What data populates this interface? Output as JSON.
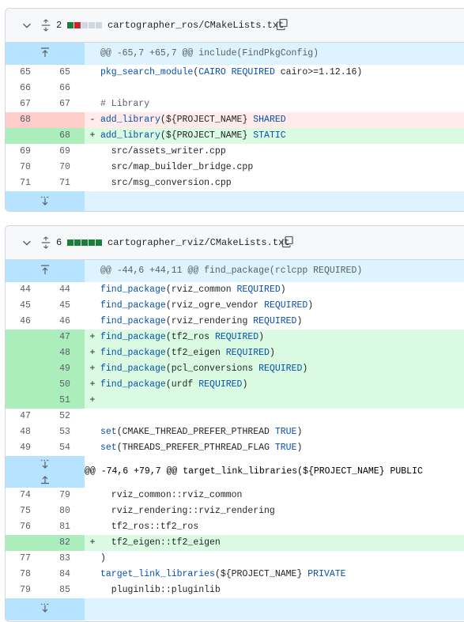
{
  "files": [
    {
      "changes": "2",
      "path": "cartographer_ros/CMakeLists.txt",
      "hunk": "@@ -65,7 +65,7 @@ include(FindPkgConfig)",
      "lines": [
        {
          "type": "ctx",
          "old": "65",
          "new": "65",
          "sign": "",
          "text": "pkg_search_module(CAIRO REQUIRED cairo>=1.12.16)"
        },
        {
          "type": "ctx",
          "old": "66",
          "new": "66",
          "sign": "",
          "text": ""
        },
        {
          "type": "ctx",
          "old": "67",
          "new": "67",
          "sign": "",
          "text": "# Library"
        },
        {
          "type": "del",
          "old": "68",
          "new": "",
          "sign": "-",
          "text": "add_library(${PROJECT_NAME} SHARED"
        },
        {
          "type": "add",
          "old": "",
          "new": "68",
          "sign": "+",
          "text": "add_library(${PROJECT_NAME} STATIC"
        },
        {
          "type": "ctx",
          "old": "69",
          "new": "69",
          "sign": "",
          "text": "  src/assets_writer.cpp"
        },
        {
          "type": "ctx",
          "old": "70",
          "new": "70",
          "sign": "",
          "text": "  src/map_builder_bridge.cpp"
        },
        {
          "type": "ctx",
          "old": "71",
          "new": "71",
          "sign": "",
          "text": "  src/msg_conversion.cpp"
        }
      ]
    },
    {
      "changes": "6",
      "path": "cartographer_rviz/CMakeLists.txt",
      "hunk": "@@ -44,6 +44,11 @@ find_package(rclcpp REQUIRED)",
      "hunk2": "@@ -74,6 +79,7 @@ target_link_libraries(${PROJECT_NAME} PUBLIC",
      "lines": [
        {
          "type": "ctx",
          "old": "44",
          "new": "44",
          "sign": "",
          "text": "find_package(rviz_common REQUIRED)"
        },
        {
          "type": "ctx",
          "old": "45",
          "new": "45",
          "sign": "",
          "text": "find_package(rviz_ogre_vendor REQUIRED)"
        },
        {
          "type": "ctx",
          "old": "46",
          "new": "46",
          "sign": "",
          "text": "find_package(rviz_rendering REQUIRED)"
        },
        {
          "type": "add",
          "old": "",
          "new": "47",
          "sign": "+",
          "text": "find_package(tf2_ros REQUIRED)"
        },
        {
          "type": "add",
          "old": "",
          "new": "48",
          "sign": "+",
          "text": "find_package(tf2_eigen REQUIRED)"
        },
        {
          "type": "add",
          "old": "",
          "new": "49",
          "sign": "+",
          "text": "find_package(pcl_conversions REQUIRED)"
        },
        {
          "type": "add",
          "old": "",
          "new": "50",
          "sign": "+",
          "text": "find_package(urdf REQUIRED)"
        },
        {
          "type": "add",
          "old": "",
          "new": "51",
          "sign": "+",
          "text": ""
        },
        {
          "type": "ctx",
          "old": "47",
          "new": "52",
          "sign": "",
          "text": ""
        },
        {
          "type": "ctx",
          "old": "48",
          "new": "53",
          "sign": "",
          "text": "set(CMAKE_THREAD_PREFER_PTHREAD TRUE)"
        },
        {
          "type": "ctx",
          "old": "49",
          "new": "54",
          "sign": "",
          "text": "set(THREADS_PREFER_PTHREAD_FLAG TRUE)"
        }
      ],
      "lines2": [
        {
          "type": "ctx",
          "old": "74",
          "new": "79",
          "sign": "",
          "text": "  rviz_common::rviz_common"
        },
        {
          "type": "ctx",
          "old": "75",
          "new": "80",
          "sign": "",
          "text": "  rviz_rendering::rviz_rendering"
        },
        {
          "type": "ctx",
          "old": "76",
          "new": "81",
          "sign": "",
          "text": "  tf2_ros::tf2_ros"
        },
        {
          "type": "add",
          "old": "",
          "new": "82",
          "sign": "+",
          "text": "  tf2_eigen::tf2_eigen"
        },
        {
          "type": "ctx",
          "old": "77",
          "new": "83",
          "sign": "",
          "text": ")"
        },
        {
          "type": "ctx",
          "old": "78",
          "new": "84",
          "sign": "",
          "text": "target_link_libraries(${PROJECT_NAME} PRIVATE"
        },
        {
          "type": "ctx",
          "old": "79",
          "new": "85",
          "sign": "",
          "text": "  pluginlib::pluginlib"
        }
      ]
    }
  ],
  "colors": {
    "add_bar": "#1a7f37",
    "del_bar": "#cf222e",
    "neutral_bar": "#d0d7de"
  }
}
